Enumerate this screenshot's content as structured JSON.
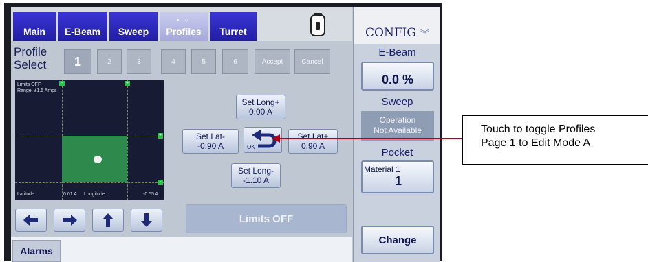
{
  "tabs": [
    {
      "label": "Main"
    },
    {
      "label": "E-Beam"
    },
    {
      "label": "Sweep"
    },
    {
      "label": "Profiles",
      "dots": "• ○"
    },
    {
      "label": "Turret"
    }
  ],
  "profile": {
    "label_line1": "Profile",
    "label_line2": "Select",
    "buttons": [
      "1",
      "2",
      "3",
      "4",
      "5",
      "6",
      "Accept",
      "Cancel"
    ],
    "selected": "1"
  },
  "plot": {
    "limits_text": "Limits OFF",
    "range_text": "Range: ±1.5 Amps",
    "latitude_label": "Latitude:",
    "latitude_value": "0.01 A",
    "longitude_label": "Longitude:",
    "longitude_value": "-0.55 A"
  },
  "actions": {
    "set_long_plus_label": "Set Long+",
    "set_long_plus_value": "0.00 A",
    "set_lat_minus_label": "Set Lat-",
    "set_lat_minus_value": "-0.90 A",
    "set_lat_plus_label": "Set Lat+",
    "set_lat_plus_value": "0.90 A",
    "set_long_minus_label": "Set Long-",
    "set_long_minus_value": "-1.10 A",
    "ok_label": "OK",
    "limits_button": "Limits OFF"
  },
  "arrows": [
    "arrow-left-icon",
    "arrow-right-icon",
    "arrow-up-icon",
    "arrow-down-icon"
  ],
  "bottom": {
    "alarms": "Alarms"
  },
  "sidebar": {
    "config_title": "CONFIG",
    "ebeam_label": "E-Beam",
    "ebeam_value": "0.0 %",
    "sweep_label": "Sweep",
    "sweep_status_line1": "Operation",
    "sweep_status_line2": "Not Available",
    "pocket_label": "Pocket",
    "material_label": "Material 1",
    "material_value": "1",
    "change_button": "Change"
  },
  "callout": {
    "line1": "Touch to toggle Profiles",
    "line2": "Page 1 to Edit Mode A"
  },
  "colors": {
    "tab_blue": "#2a26c0",
    "panel": "#bfc7d2",
    "plot_bg": "#171b33",
    "zone_green": "#2e8a4c",
    "callout_red": "#b00018"
  }
}
